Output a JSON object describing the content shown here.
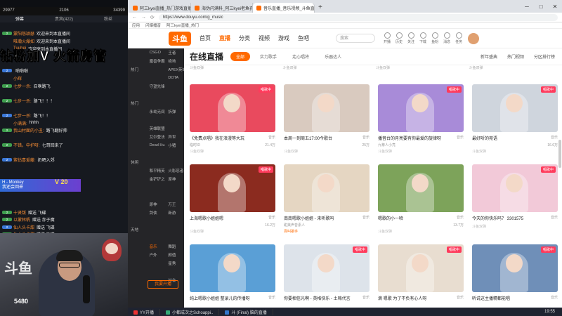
{
  "chat": {
    "stats": {
      "viewers": "29977",
      "fans": "2106",
      "rank": "34399"
    },
    "tabs": [
      "弹幕",
      "贵宾(422)",
      "粉丝"
    ],
    "messages": [
      {
        "badge": "",
        "user": "",
        "text": ""
      },
      {
        "badge": "2",
        "user": "蒙阳怒颖瑟",
        "text": "欢迎来到本直播间"
      },
      {
        "badge": "",
        "user": "唯瀚火爆如",
        "text": "欢迎来到本直播间"
      },
      {
        "badge": "",
        "user": "Tuuhei",
        "text": "欢迎来到本直播间"
      },
      {
        "badge": "",
        "user": "",
        "text": ""
      },
      {
        "badge": "",
        "user": "",
        "text": ""
      },
      {
        "badge": "2",
        "user": "",
        "text": "啪啪啪"
      },
      {
        "badge": "",
        "user": "小辉",
        "text": ""
      },
      {
        "badge": "2",
        "user": "七步一杀:",
        "text": "召唤路飞"
      },
      {
        "badge": "",
        "user": "",
        "text": ""
      },
      {
        "badge": "2",
        "user": "七步一杀:",
        "text": "路飞！！！"
      },
      {
        "badge": "",
        "user": "",
        "text": ""
      },
      {
        "badge": "2",
        "user": "七步一杀:",
        "text": "路飞！！"
      },
      {
        "badge": "",
        "user": "小满满:",
        "text": "hhhh"
      },
      {
        "badge": "2",
        "user": "我山村面的小丑:",
        "text": "路飞翻好帅"
      },
      {
        "badge": "",
        "user": "",
        "text": ""
      },
      {
        "badge": "2",
        "user": "不错。中护呀:",
        "text": "七哥回来了"
      },
      {
        "badge": "",
        "user": "",
        "text": ""
      },
      {
        "badge": "2",
        "user": "紫钻喜爱藤:",
        "text": "扔晒入郊"
      },
      {
        "badge": "",
        "user": "",
        "text": ""
      },
      {
        "badge": "",
        "user": "",
        "text": ""
      },
      {
        "badge": "3",
        "user": "天天Twitter",
        "text": "赠送 大气"
      },
      {
        "badge": "",
        "user": "",
        "text": ""
      },
      {
        "badge": "",
        "user": "",
        "text": ""
      },
      {
        "badge": "",
        "user": "",
        "text": ""
      },
      {
        "badge": "2",
        "user": "十贤叛",
        "text": "赠送 飞碟"
      },
      {
        "badge": "2",
        "user": "以蒙林帆",
        "text": "赠送 赤子魔"
      },
      {
        "badge": "2",
        "user": "仙人头卡甜",
        "text": "赠送 飞碟"
      },
      {
        "badge": "2",
        "user": "仙人头卡甜",
        "text": "赠送 飞碟"
      }
    ],
    "overlay": "钻粉加V 火箭房管",
    "join": {
      "name": "H - Monkey",
      "text": "我还会回来",
      "level": "V 20"
    }
  },
  "webcam": {
    "logo": "斗鱼",
    "logo_sub": "",
    "room_id": "5480"
  },
  "browser": {
    "tabs": [
      {
        "title": "阿三kyei直播_热门游戏直播_斗"
      },
      {
        "title": "海伪闪满科_阿三kyei老鱼孔_斗"
      },
      {
        "title": "音乐直播_音乐视频_斗鱼直播"
      }
    ],
    "url": "https://www.douyu.com/g_music",
    "bookmarks": [
      "应用",
      "闪爆播音",
      "阿三kyei直播_热门"
    ],
    "site": {
      "logo": "斗鱼",
      "nav": [
        "首页",
        "直播",
        "分类",
        "视频",
        "游戏",
        "鱼吧"
      ],
      "search_placeholder": "搜索",
      "icons": [
        "开播",
        "历史",
        "关注",
        "下载",
        "鱼粉",
        "消息",
        "任务"
      ]
    },
    "sidemenu": [
      [
        "",
        "CSGO",
        "王者"
      ],
      [
        "",
        "魔兽争霸",
        "绝地"
      ],
      [
        "热门",
        "",
        "APEX英雄"
      ],
      [
        "",
        "",
        "DOTA"
      ],
      [
        "",
        "守望先锋",
        ""
      ],
      [
        "",
        "",
        ""
      ],
      [
        "热门",
        "",
        ""
      ],
      [
        "",
        "永劫无间",
        "拆弹"
      ],
      [
        "",
        "",
        ""
      ],
      [
        "",
        "英雄联盟",
        ""
      ],
      [
        "",
        "艾尔登法环",
        "异世"
      ],
      [
        "",
        "Dead Hu..",
        "小猪"
      ],
      [
        "",
        "",
        ""
      ],
      [
        "休闲",
        "",
        ""
      ],
      [
        "",
        "和平精英",
        "火影忍者"
      ],
      [
        "",
        "金铲铲之战",
        "原神"
      ],
      [
        "",
        "",
        ""
      ],
      [
        "",
        "",
        ""
      ],
      [
        "",
        "原神",
        "万王"
      ],
      [
        "",
        "剑侠",
        "新游"
      ],
      [
        "",
        "",
        ""
      ],
      [
        "天地",
        "",
        ""
      ],
      [
        "",
        "",
        ""
      ],
      [
        "",
        "音乐",
        "舞蹈"
      ],
      [
        "",
        "户外",
        "颜值"
      ],
      [
        "",
        "",
        "星秀"
      ],
      [
        "",
        "",
        ""
      ],
      [
        "",
        "",
        "社会"
      ]
    ],
    "sidemenu_button": "我要开播",
    "main": {
      "title": "在线直播",
      "filters": [
        "全部",
        "实力歌手",
        "走心唱将",
        "乐器达人"
      ],
      "actions": [
        "新年盛典",
        "热门视频",
        "分区排行榜"
      ],
      "strip": [
        "斗鱼双弹",
        "斗鱼双弹",
        "斗鱼双弹",
        "斗鱼双弹"
      ],
      "cards": [
        {
          "title": "《免费点唱》我在浪漫等大玩",
          "cat": "音乐",
          "host": "临时ID",
          "heat": "21.4万",
          "tag": "斗鱼双弹",
          "live": "唱歌中",
          "color": "#e94a5e"
        },
        {
          "title": "本周一到周五17:00今歌台",
          "cat": "音乐",
          "host": "",
          "heat": "25万",
          "tag": "斗鱼双弹",
          "live": "",
          "color": "#d9cabf"
        },
        {
          "title": "播音台的月亮要有你最爱的旋律呀",
          "cat": "音乐",
          "host": "九蒂人小亮",
          "heat": "",
          "tag": "斗鱼双弹",
          "live": "唱歌中",
          "color": "#a88bd8"
        },
        {
          "title": "最好听的苑语",
          "cat": "音乐",
          "host": "",
          "heat": "16.6万",
          "tag": "斗鱼双弹",
          "live": "唱歌中",
          "color": "#cfd5dd"
        },
        {
          "title": "上海嗯歌小姐姐嗯",
          "cat": "音乐",
          "host": "",
          "heat": "16.2万",
          "tag": "斗鱼双弹",
          "live": "唱歌中",
          "color": "#8b2b1f"
        },
        {
          "title": "南南嗯歌小姐姐 - 来听歌吗",
          "cat": "音乐",
          "host": "甜美声音素人",
          "heat": "",
          "tag": "百叫歌手",
          "live": "",
          "color": "#e5d6c2"
        },
        {
          "title": "嗯歌的小一哈",
          "cat": "音乐",
          "host": "",
          "heat": "13.7万",
          "tag": "斗鱼双弹",
          "live": "",
          "color": "#7da35a"
        },
        {
          "title": "今天的你快乐吗？ 3301575",
          "cat": "音乐",
          "host": "",
          "heat": "",
          "tag": "斗鱼双弹",
          "live": "唱歌中",
          "color": "#f2c9d8"
        },
        {
          "title": "纯上嗯歌小姐姐 整录儿的传播呀",
          "cat": "音乐",
          "host": "",
          "heat": "",
          "tag": "",
          "live": "",
          "color": "#5a9fd6"
        },
        {
          "title": "你要相信光啊 - 英格快乐 - 土嗨代言",
          "cat": "音乐",
          "host": "",
          "heat": "",
          "tag": "",
          "live": "唱歌中",
          "color": "#dde3ea"
        },
        {
          "title": "滴 嗯歌 为了不负有心人呀",
          "cat": "音乐",
          "host": "",
          "heat": "",
          "tag": "",
          "live": "唱歌中",
          "color": "#e8ddd0"
        },
        {
          "title": "听说这主播精都能唱",
          "cat": "音乐",
          "host": "",
          "heat": "",
          "tag": "",
          "live": "唱歌中",
          "color": "#6f8fb8"
        }
      ]
    }
  },
  "taskbar": {
    "items": [
      "YY开播",
      "小都成次之Schoappi..",
      "斗 (Final) 脑的直播"
    ],
    "time": "19:55"
  }
}
